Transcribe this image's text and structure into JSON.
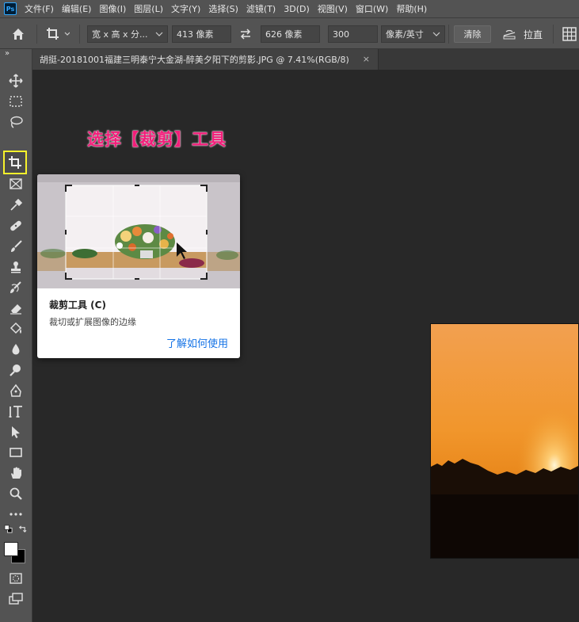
{
  "app": {
    "logo": "Ps"
  },
  "menu": [
    "文件(F)",
    "编辑(E)",
    "图像(I)",
    "图层(L)",
    "文字(Y)",
    "选择(S)",
    "滤镜(T)",
    "3D(D)",
    "视图(V)",
    "窗口(W)",
    "帮助(H)"
  ],
  "options": {
    "ratio_preset": "宽 x 高 x 分...",
    "width_value": "413 像素",
    "height_value": "626 像素",
    "resolution_value": "300",
    "resolution_unit": "像素/英寸",
    "clear_label": "清除",
    "straighten_label": "拉直"
  },
  "document": {
    "tab_title": "胡挺-20181001福建三明泰宁大金湖-醉美夕阳下的剪影.JPG @ 7.41%(RGB/8)",
    "close_symbol": "×"
  },
  "annotation": {
    "text": "选择【裁剪】工具"
  },
  "tooltip": {
    "title": "裁剪工具 (C)",
    "description": "裁切或扩展图像的边缘",
    "link": "了解如何使用"
  },
  "toolbar": {
    "collapse_symbol": "»",
    "tools": [
      "move-tool",
      "marquee-tool",
      "lasso-tool",
      "crop-tool",
      "frame-tool",
      "eyedropper-tool",
      "healing-tool",
      "brush-tool",
      "stamp-tool",
      "history-brush-tool",
      "eraser-tool",
      "paint-bucket-tool",
      "blur-tool",
      "dodge-tool",
      "pen-tool",
      "type-tool",
      "path-select-tool",
      "rectangle-tool",
      "hand-tool",
      "zoom-tool",
      "more-tools",
      "quick-mask",
      "screen-mode"
    ],
    "selected_tool": "crop-tool"
  },
  "colors": {
    "ui_panel": "#535353",
    "canvas": "#282828",
    "selection_highlight": "#f8f22b",
    "annotation": "#f21e7a",
    "link": "#1473e6"
  }
}
